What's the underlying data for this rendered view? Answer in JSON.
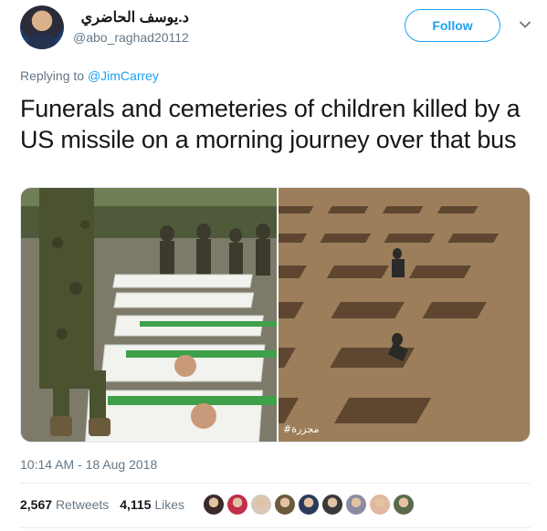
{
  "author": {
    "display_name": "د.يوسف الحاضري",
    "handle": "@abo_raghad20112"
  },
  "follow_label": "Follow",
  "reply": {
    "prefix": "Replying to ",
    "target": "@JimCarrey"
  },
  "tweet_text": "Funerals and cemeteries of children killed by a US missile on a morning journey over that bus",
  "timestamp": "10:14 AM - 18 Aug 2018",
  "stats": {
    "retweets_count": "2,567",
    "retweets_label": "Retweets",
    "likes_count": "4,115",
    "likes_label": "Likes"
  },
  "photo_watermark": "#مجزرة",
  "colors": {
    "accent": "#1da1f2",
    "secondary_text": "#657786",
    "primary_text": "#14171a"
  },
  "liker_avatars": [
    "#3a2a2a",
    "#c0304a",
    "#d8c8b8",
    "#6b5a3a",
    "#2a3a5a",
    "#3a3a3a",
    "#8a8aa0",
    "#e0b8a0",
    "#5a6a4a"
  ]
}
